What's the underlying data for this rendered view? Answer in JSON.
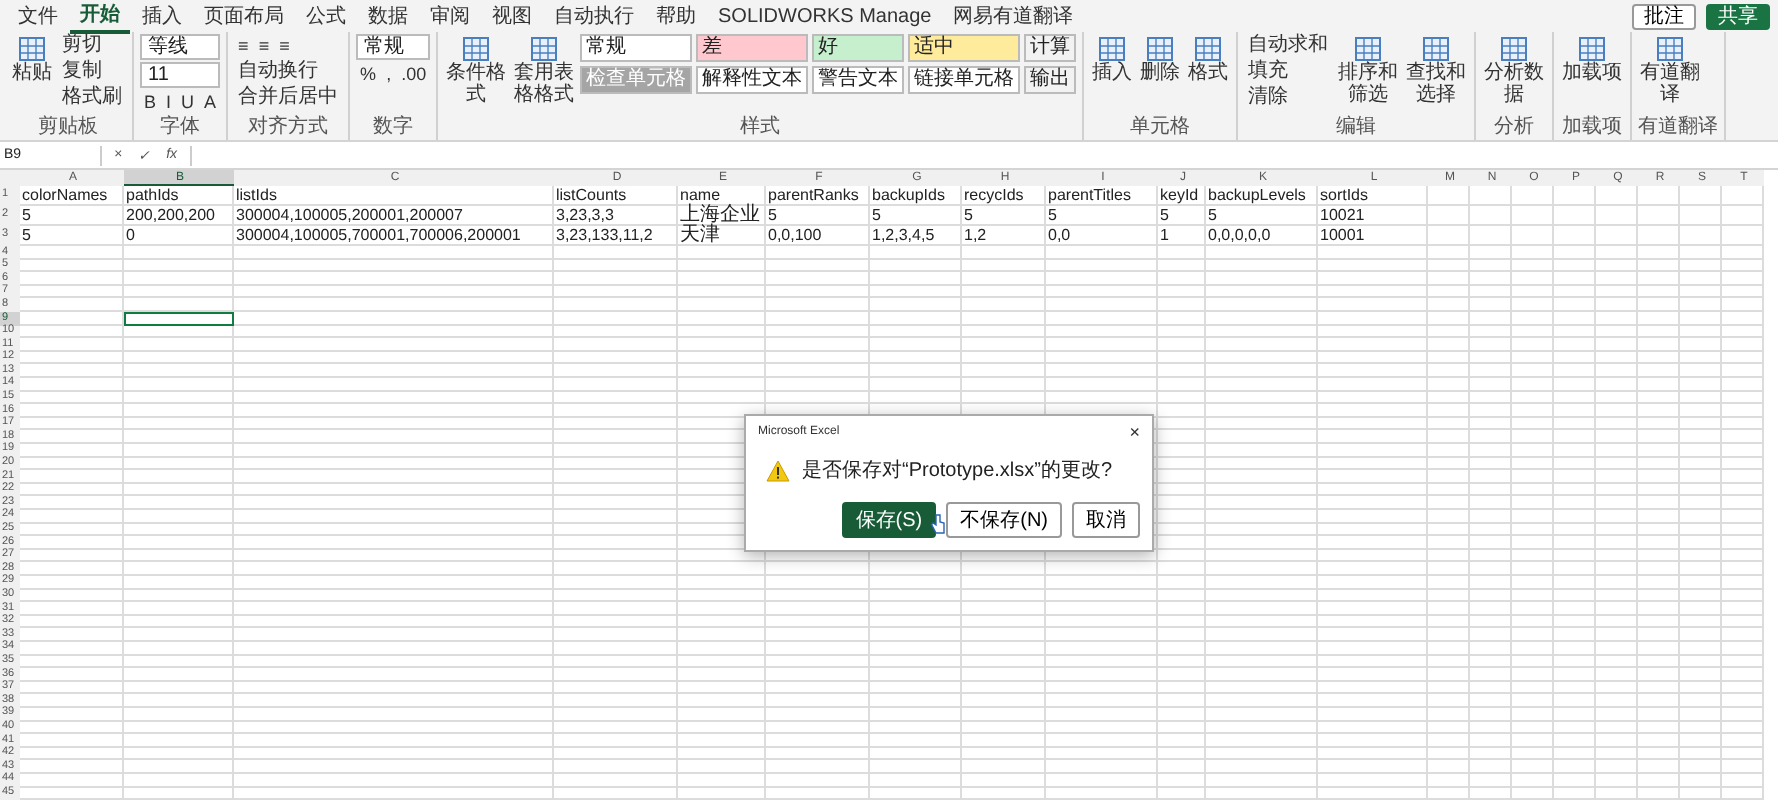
{
  "tabs": [
    {
      "label": "文件",
      "selected": false
    },
    {
      "label": "开始",
      "selected": true
    },
    {
      "label": "插入",
      "selected": false
    },
    {
      "label": "页面布局",
      "selected": false
    },
    {
      "label": "公式",
      "selected": false
    },
    {
      "label": "数据",
      "selected": false
    },
    {
      "label": "审阅",
      "selected": false
    },
    {
      "label": "视图",
      "selected": false
    },
    {
      "label": "自动执行",
      "selected": false
    },
    {
      "label": "帮助",
      "selected": false
    },
    {
      "label": "SOLIDWORKS Manage",
      "selected": false
    },
    {
      "label": "网易有道翻译",
      "selected": false
    }
  ],
  "top_buttons": [
    {
      "kind": "comment",
      "label": "批注"
    },
    {
      "kind": "share",
      "label": "共享"
    }
  ],
  "ribbon": [
    {
      "label": "剪贴板",
      "items": [
        {
          "kind": "large",
          "label": "粘贴"
        },
        {
          "kind": "small",
          "label": "剪切"
        },
        {
          "kind": "small",
          "label": "复制"
        },
        {
          "kind": "small",
          "label": "格式刷"
        }
      ]
    },
    {
      "label": "字体",
      "items": [
        {
          "kind": "field",
          "label": "等线"
        },
        {
          "kind": "field",
          "label": "11"
        },
        {
          "kind": "row",
          "labels": [
            "B",
            "I",
            "U",
            "A"
          ]
        }
      ]
    },
    {
      "label": "对齐方式",
      "items": [
        {
          "kind": "row",
          "labels": [
            "≡",
            "≡",
            "≡"
          ]
        },
        {
          "kind": "small",
          "label": "自动换行"
        },
        {
          "kind": "small",
          "label": "合并后居中"
        }
      ]
    },
    {
      "label": "数字",
      "items": [
        {
          "kind": "field",
          "label": "常规"
        },
        {
          "kind": "row",
          "labels": [
            "%",
            ",",
            ".00"
          ]
        }
      ]
    },
    {
      "label": "样式",
      "items": [
        {
          "kind": "large",
          "label": "条件格式"
        },
        {
          "kind": "large",
          "label": "套用表格格式"
        },
        {
          "kind": "style",
          "label": "常规",
          "color": "#ffffff"
        },
        {
          "kind": "style",
          "label": "检查单元格",
          "color": "#a5a5a5"
        },
        {
          "kind": "style",
          "label": "差",
          "color": "#ffc7ce"
        },
        {
          "kind": "style",
          "label": "解释性文本",
          "color": "#ffffff"
        },
        {
          "kind": "style",
          "label": "好",
          "color": "#c6efce"
        },
        {
          "kind": "style",
          "label": "警告文本",
          "color": "#ffffff"
        },
        {
          "kind": "style",
          "label": "适中",
          "color": "#ffeb9c"
        },
        {
          "kind": "style",
          "label": "链接单元格",
          "color": "#ffffff"
        },
        {
          "kind": "style",
          "label": "计算",
          "color": "#f2f2f2"
        },
        {
          "kind": "style",
          "label": "输出",
          "color": "#f2f2f2"
        }
      ]
    },
    {
      "label": "单元格",
      "items": [
        {
          "kind": "large",
          "label": "插入"
        },
        {
          "kind": "large",
          "label": "删除"
        },
        {
          "kind": "large",
          "label": "格式"
        }
      ]
    },
    {
      "label": "编辑",
      "items": [
        {
          "kind": "small",
          "label": "自动求和"
        },
        {
          "kind": "small",
          "label": "填充"
        },
        {
          "kind": "small",
          "label": "清除"
        },
        {
          "kind": "large",
          "label": "排序和筛选"
        },
        {
          "kind": "large",
          "label": "查找和选择"
        }
      ]
    },
    {
      "label": "分析",
      "items": [
        {
          "kind": "large",
          "label": "分析数据"
        }
      ]
    },
    {
      "label": "加载项",
      "items": [
        {
          "kind": "large",
          "label": "加载项"
        }
      ]
    },
    {
      "label": "有道翻译",
      "items": [
        {
          "kind": "large",
          "label": "有道翻译"
        }
      ]
    }
  ],
  "formula_bar": {
    "name_box": "B9",
    "buttons": [
      "×",
      "✓",
      "fx"
    ]
  },
  "columns": [
    {
      "letter": "A",
      "selected": false
    },
    {
      "letter": "B",
      "selected": true
    },
    {
      "letter": "C",
      "selected": false
    },
    {
      "letter": "D",
      "selected": false
    },
    {
      "letter": "E",
      "selected": false
    },
    {
      "letter": "F",
      "selected": false
    },
    {
      "letter": "G",
      "selected": false
    },
    {
      "letter": "H",
      "selected": false
    },
    {
      "letter": "I",
      "selected": false
    },
    {
      "letter": "J",
      "selected": false
    },
    {
      "letter": "K",
      "selected": false
    },
    {
      "letter": "L",
      "selected": false
    },
    {
      "letter": "M",
      "selected": false
    },
    {
      "letter": "N",
      "selected": false
    },
    {
      "letter": "O",
      "selected": false
    },
    {
      "letter": "P",
      "selected": false
    },
    {
      "letter": "Q",
      "selected": false
    },
    {
      "letter": "R",
      "selected": false
    },
    {
      "letter": "S",
      "selected": false
    },
    {
      "letter": "T",
      "selected": false
    }
  ],
  "rows": [
    {
      "number": "1",
      "selected": false,
      "cells": [
        "colorNames",
        "pathIds",
        "listIds",
        "listCounts",
        "name",
        "parentRanks",
        "backupIds",
        "recycIds",
        "parentTitles",
        "keyId",
        "backupLevels",
        "sortIds"
      ]
    },
    {
      "number": "2",
      "selected": false,
      "cells": [
        "5",
        "200,200,200",
        "300004,100005,200001,200007",
        "3,23,3,3",
        "上海企业",
        "5",
        "5",
        "5",
        "5",
        "5",
        "5",
        "10021"
      ]
    },
    {
      "number": "3",
      "selected": false,
      "cells": [
        "5",
        "0",
        "300004,100005,700001,700006,200001",
        "3,23,133,11,2",
        "天津",
        "0,0,100",
        "1,2,3,4,5",
        "1,2",
        "0,0",
        "1",
        "0,0,0,0,0",
        "10001"
      ]
    },
    {
      "number": "4",
      "selected": false
    },
    {
      "number": "5",
      "selected": false
    },
    {
      "number": "6",
      "selected": false
    },
    {
      "number": "7",
      "selected": false
    },
    {
      "number": "8",
      "selected": false
    },
    {
      "number": "9",
      "selected": true
    },
    {
      "number": "10",
      "selected": false
    },
    {
      "number": "11",
      "selected": false
    },
    {
      "number": "12",
      "selected": false
    },
    {
      "number": "13",
      "selected": false
    },
    {
      "number": "14",
      "selected": false
    },
    {
      "number": "15",
      "selected": false
    },
    {
      "number": "16",
      "selected": false
    },
    {
      "number": "17",
      "selected": false
    },
    {
      "number": "18",
      "selected": false
    },
    {
      "number": "19",
      "selected": false
    },
    {
      "number": "20",
      "selected": false
    },
    {
      "number": "21",
      "selected": false
    },
    {
      "number": "22",
      "selected": false
    },
    {
      "number": "23",
      "selected": false
    },
    {
      "number": "24",
      "selected": false
    },
    {
      "number": "25",
      "selected": false
    },
    {
      "number": "26",
      "selected": false
    },
    {
      "number": "27",
      "selected": false
    },
    {
      "number": "28",
      "selected": false
    },
    {
      "number": "29",
      "selected": false
    },
    {
      "number": "30",
      "selected": false
    },
    {
      "number": "31",
      "selected": false
    },
    {
      "number": "32",
      "selected": false
    },
    {
      "number": "33",
      "selected": false
    },
    {
      "number": "34",
      "selected": false
    },
    {
      "number": "35",
      "selected": false
    },
    {
      "number": "36",
      "selected": false
    },
    {
      "number": "37",
      "selected": false
    },
    {
      "number": "38",
      "selected": false
    },
    {
      "number": "39",
      "selected": false
    },
    {
      "number": "40",
      "selected": false
    },
    {
      "number": "41",
      "selected": false
    },
    {
      "number": "42",
      "selected": false
    },
    {
      "number": "43",
      "selected": false
    },
    {
      "number": "44",
      "selected": false
    },
    {
      "number": "45",
      "selected": false
    }
  ],
  "dialog": {
    "title": "Microsoft Excel",
    "close": "×",
    "message": "是否保存对“Prototype.xlsx”的更改?",
    "buttons": [
      {
        "label": "保存(S)",
        "selected": true
      },
      {
        "label": "不保存(N)",
        "selected": false
      },
      {
        "label": "取消",
        "selected": false
      }
    ]
  }
}
